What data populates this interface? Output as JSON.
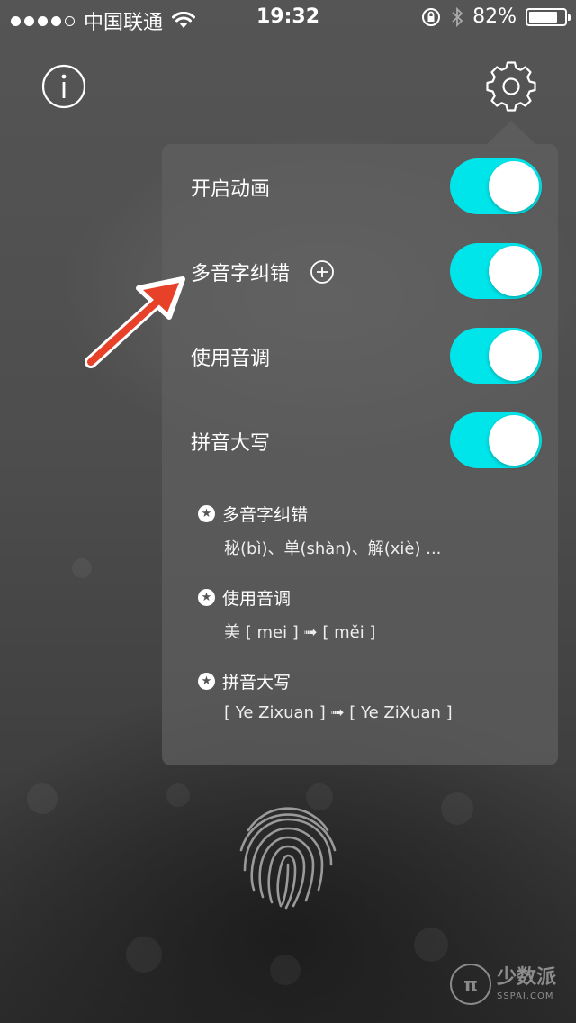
{
  "status_bar": {
    "carrier": "中国联通",
    "time": "19:32",
    "battery_percent": "82%",
    "battery_level": 0.82,
    "signal_dots": 4
  },
  "top_bar": {
    "info_icon": "info-icon",
    "settings_icon": "gear-icon"
  },
  "settings": {
    "toggles": [
      {
        "label": "开启动画",
        "on": true
      },
      {
        "label": "多音字纠错",
        "on": true
      },
      {
        "label": "使用音调",
        "on": true
      },
      {
        "label": "拼音大写",
        "on": true
      }
    ],
    "notes": [
      {
        "title": "多音字纠错",
        "body": "秘(bì)、单(shàn)、解(xiè) ..."
      },
      {
        "title": "使用音调",
        "body": "美 [ mei ] ➟ [ měi ]"
      },
      {
        "title": "拼音大写",
        "body": "[ Ye Zixuan ] ➟ [ Ye ZiXuan ]"
      }
    ]
  },
  "colors": {
    "toggle_on": "#00e5ea",
    "arrow": "#e8412a"
  },
  "watermark": {
    "logo": "π",
    "name": "少数派",
    "site": "SSPAI.COM"
  }
}
